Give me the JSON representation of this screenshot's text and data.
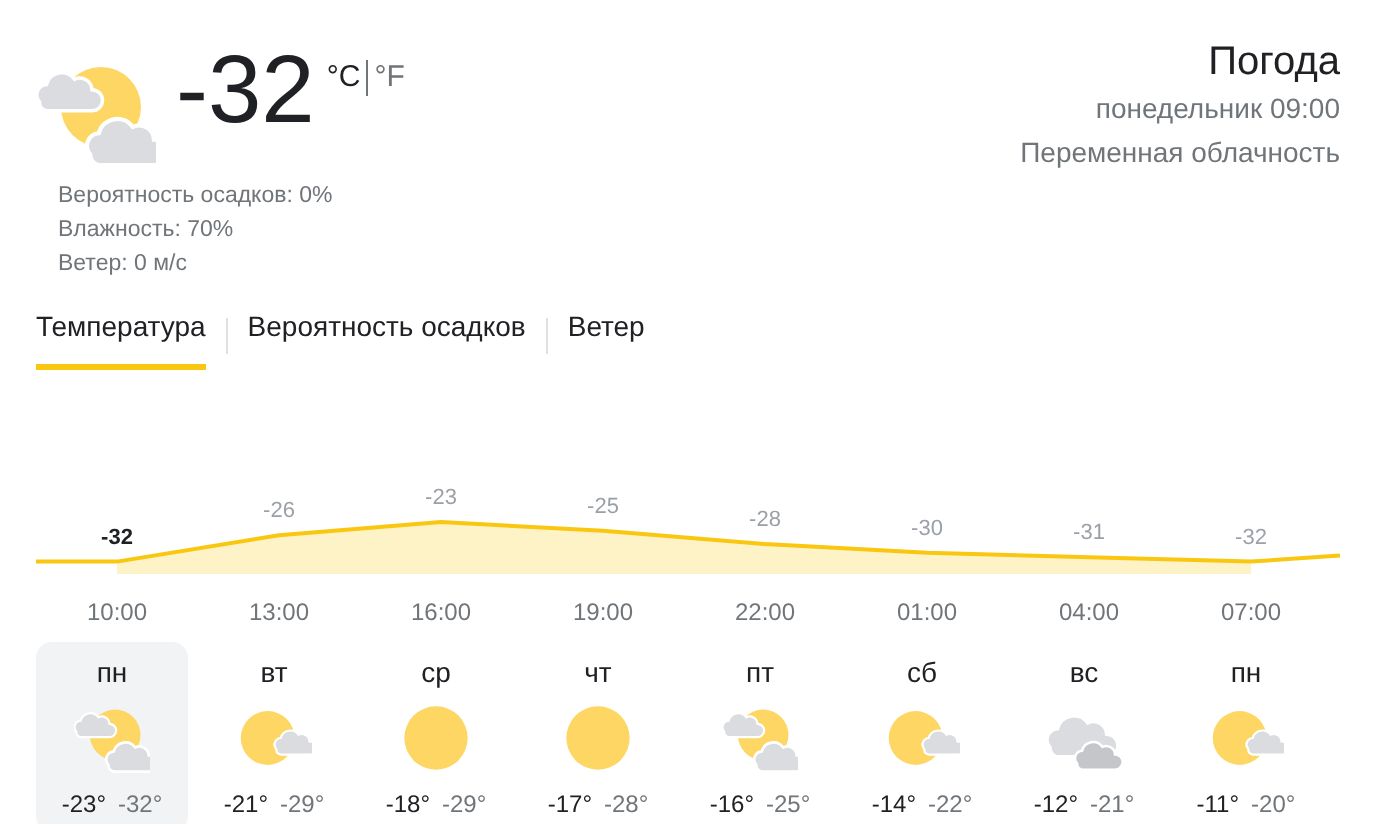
{
  "current": {
    "kind": "partly_cloudy",
    "temperature": "-32",
    "units": [
      {
        "label": "°C",
        "selected": true
      },
      {
        "label": "°F",
        "selected": false
      }
    ],
    "details": [
      "Вероятность осадков: 0%",
      "Влажность: 70%",
      "Ветер: 0 м/с"
    ]
  },
  "header": {
    "title": "Погода",
    "time": "понедельник 09:00",
    "condition": "Переменная облачность"
  },
  "tabs": [
    {
      "label": "Температура",
      "selected": true
    },
    {
      "label": "Вероятность осадков",
      "selected": false
    },
    {
      "label": "Ветер",
      "selected": false
    }
  ],
  "chart": {
    "chart_data": {
      "type": "area",
      "categories": [
        "10:00",
        "13:00",
        "16:00",
        "19:00",
        "22:00",
        "01:00",
        "04:00",
        "07:00"
      ],
      "values": [
        -32,
        -26,
        -23,
        -25,
        -28,
        -30,
        -31,
        -32
      ],
      "data_labels": true
    }
  },
  "days": [
    {
      "day": "пн",
      "kind": "partly_cloudy",
      "high": "-23°",
      "low": "-32°",
      "selected": true
    },
    {
      "day": "вт",
      "kind": "sun_cloud",
      "high": "-21°",
      "low": "-29°",
      "selected": false
    },
    {
      "day": "ср",
      "kind": "sunny",
      "high": "-18°",
      "low": "-29°",
      "selected": false
    },
    {
      "day": "чт",
      "kind": "sunny",
      "high": "-17°",
      "low": "-28°",
      "selected": false
    },
    {
      "day": "пт",
      "kind": "partly_cloudy",
      "high": "-16°",
      "low": "-25°",
      "selected": false
    },
    {
      "day": "сб",
      "kind": "sun_cloud",
      "high": "-14°",
      "low": "-22°",
      "selected": false
    },
    {
      "day": "вс",
      "kind": "cloudy",
      "high": "-12°",
      "low": "-21°",
      "selected": false
    },
    {
      "day": "пн",
      "kind": "sun_cloud",
      "high": "-11°",
      "low": "-20°",
      "selected": false
    }
  ]
}
